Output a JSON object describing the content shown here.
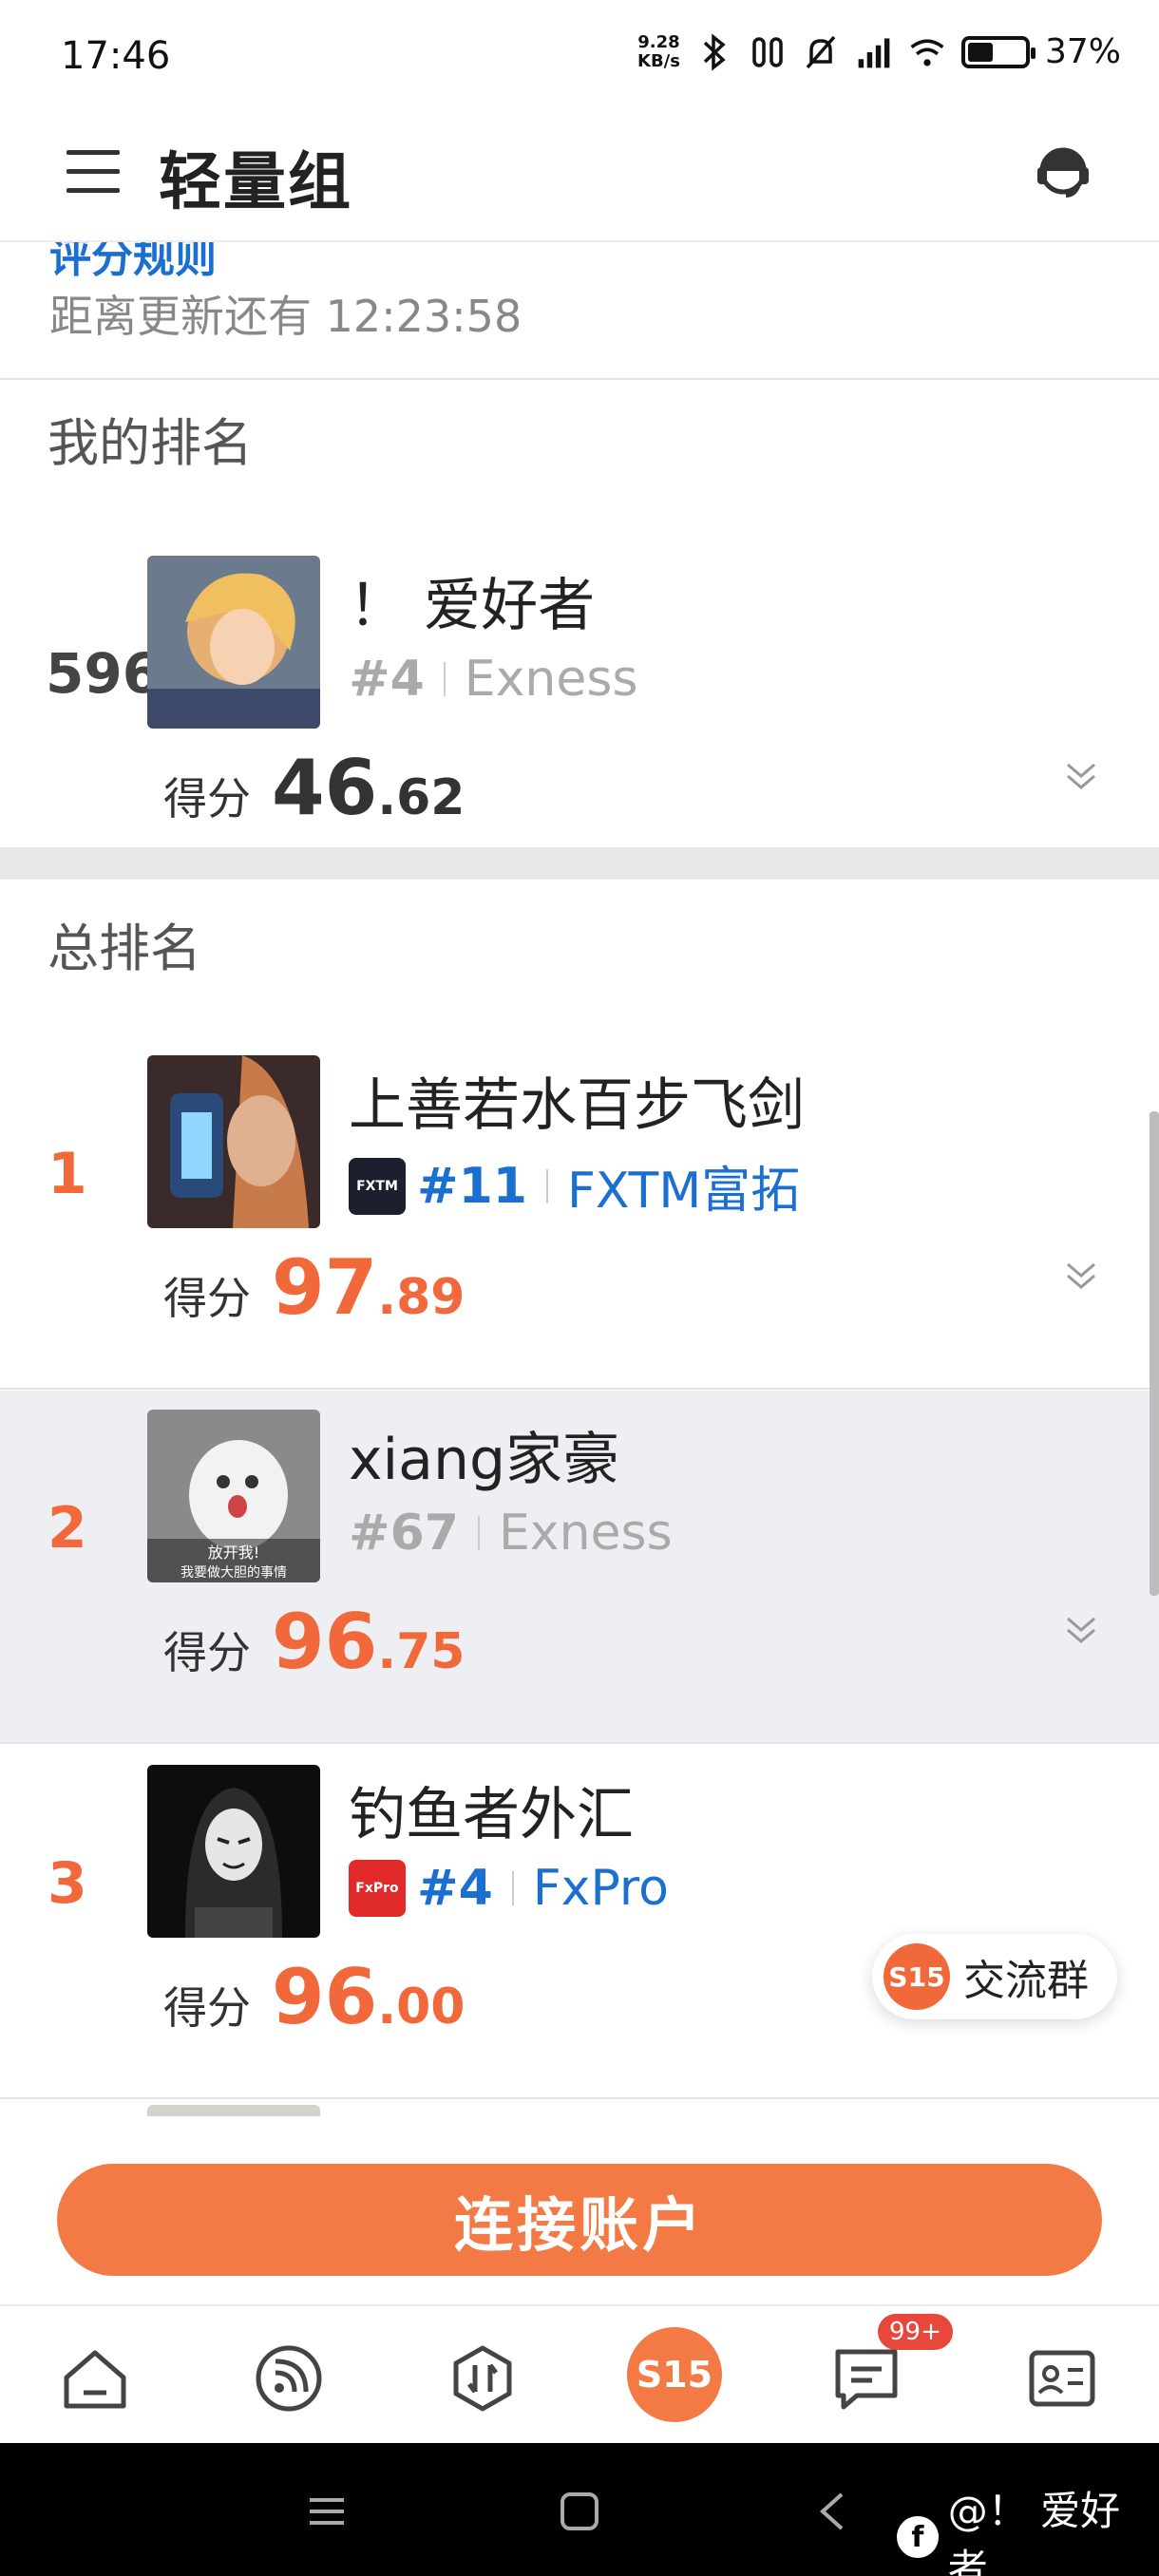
{
  "status_bar": {
    "time": "17:46",
    "net_speed_value": "9.28",
    "net_speed_unit": "KB/s",
    "battery": "37%"
  },
  "app_bar": {
    "title": "轻量组"
  },
  "info": {
    "rules_link": "评分规则",
    "countdown": "距离更新还有 12:23:58"
  },
  "my_ranking": {
    "title": "我的排名",
    "rank": "596",
    "name": "！ 爱好者",
    "broker_rank": "#4",
    "broker": "Exness",
    "score_label": "得分",
    "score_int": "46",
    "score_dec": ".62"
  },
  "overall": {
    "title": "总排名",
    "rows": [
      {
        "rank": "1",
        "name": "上善若水百步飞剑",
        "broker_rank": "#11",
        "broker": "FXTM富拓",
        "broker_logo_text": "FXTM",
        "score_label": "得分",
        "score_int": "97",
        "score_dec": ".89"
      },
      {
        "rank": "2",
        "name": "xiang家豪",
        "broker_rank": "#67",
        "broker": "Exness",
        "score_label": "得分",
        "score_int": "96",
        "score_dec": ".75",
        "avatar_caption_1": "放开我!",
        "avatar_caption_2": "我要做大胆的事情"
      },
      {
        "rank": "3",
        "name": "钓鱼者外汇",
        "broker_rank": "#4",
        "broker": "FxPro",
        "broker_logo_text": "FxPro",
        "score_label": "得分",
        "score_int": "96",
        "score_dec": ".00"
      }
    ]
  },
  "float_chat": {
    "badge": "S15",
    "label": "交流群"
  },
  "cta": {
    "label": "连接账户"
  },
  "tab_bar": {
    "center_label": "S15",
    "message_badge": "99+"
  },
  "watermark": {
    "text": "@！ 爱好者"
  },
  "colors": {
    "accent": "#f47a45",
    "link": "#1a6fd1",
    "muted": "#888888"
  }
}
